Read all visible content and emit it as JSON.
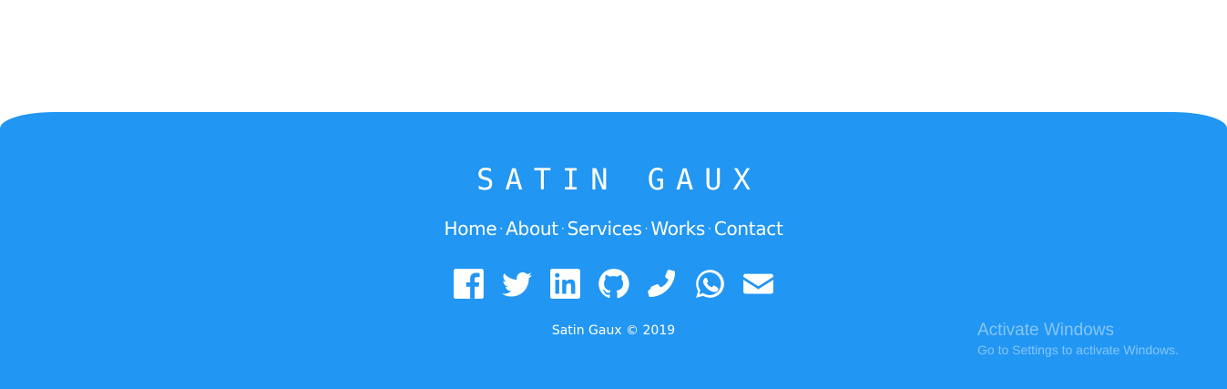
{
  "footer": {
    "background": "#2196F3",
    "logo": "SATIN GAUX",
    "nav": [
      {
        "label": "Home"
      },
      {
        "label": "About"
      },
      {
        "label": "Services"
      },
      {
        "label": "Works"
      },
      {
        "label": "Contact"
      }
    ],
    "separator": "·",
    "social": [
      "facebook-icon",
      "twitter-icon",
      "linkedin-icon",
      "github-icon",
      "phone-icon",
      "whatsapp-icon",
      "envelope-icon"
    ],
    "copyright": "Satin Gaux © 2019"
  },
  "watermark": {
    "title": "Activate Windows",
    "subtitle": "Go to Settings to activate Windows."
  }
}
